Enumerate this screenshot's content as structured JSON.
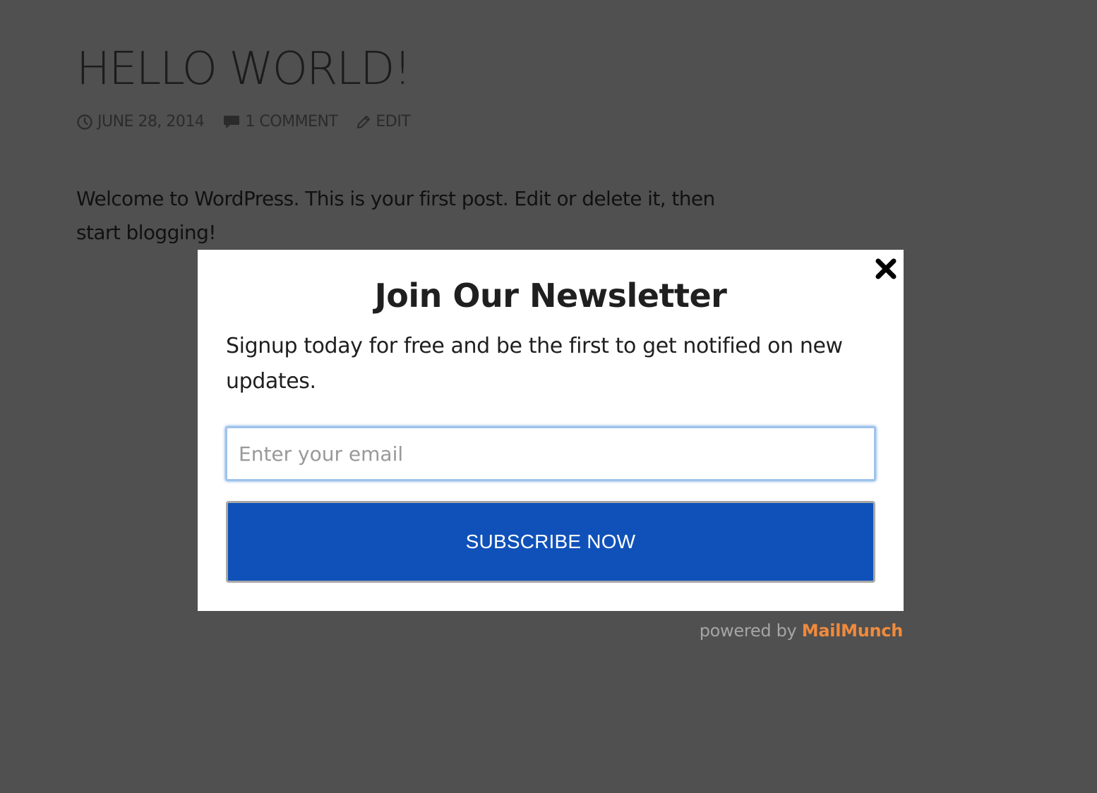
{
  "post": {
    "title": "HELLO WORLD!",
    "meta": {
      "date": "JUNE 28, 2014",
      "comments": "1 COMMENT",
      "edit": "EDIT"
    },
    "body": "Welcome to WordPress. This is your first post. Edit or delete it, then start blogging!"
  },
  "popup": {
    "title": "Join Our Newsletter",
    "description": "Signup today for free and be the first to get notified on new updates.",
    "email_placeholder": "Enter your email",
    "email_value": "",
    "subscribe_label": "SUBSCRIBE NOW",
    "close_icon": "close-x-icon"
  },
  "footer": {
    "powered_by": "powered by",
    "brand": "MailMunch"
  },
  "colors": {
    "overlay": "#505050",
    "button": "#0f51b9",
    "brand": "#f08a3c",
    "input_focus": "#9ec3ec"
  }
}
